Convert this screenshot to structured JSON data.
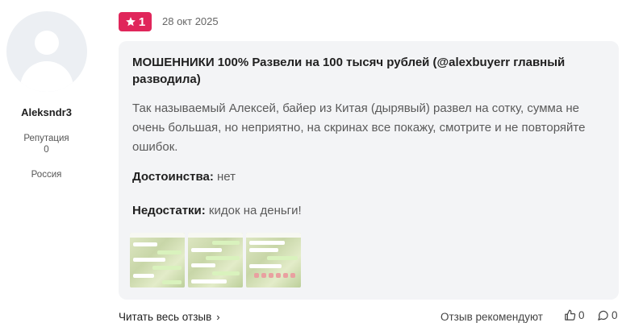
{
  "author": {
    "name": "Aleksndr3",
    "reputation_label": "Репутация",
    "reputation_value": "0",
    "country": "Россия"
  },
  "review": {
    "rating": "1",
    "date": "28 окт 2025",
    "title": "МОШЕННИКИ 100% Развели на 100 тысяч рублей (@alexbuyerr главный разводила)",
    "text": "Так называемый Алексей, байер из Китая (дырявый) развел на сотку, сумма не очень большая, но неприятно, на скринах все покажу, смотрите и не повторяйте ошибок.",
    "pros_label": "Достоинства:",
    "pros_value": " нет",
    "cons_label": "Недостатки:",
    "cons_value": " кидок на деньги!",
    "attachments": [
      "screenshot-1",
      "screenshot-2",
      "screenshot-3"
    ]
  },
  "footer": {
    "read_full_label": "Читать весь отзыв",
    "recommend_label": "Отзыв рекомендуют",
    "likes": "0",
    "comments": "0"
  },
  "colors": {
    "badge": "#e0265b",
    "card_bg": "#f3f4f6"
  },
  "icons": [
    "star-icon",
    "chevron-right-icon",
    "thumbs-up-icon",
    "comment-icon"
  ]
}
